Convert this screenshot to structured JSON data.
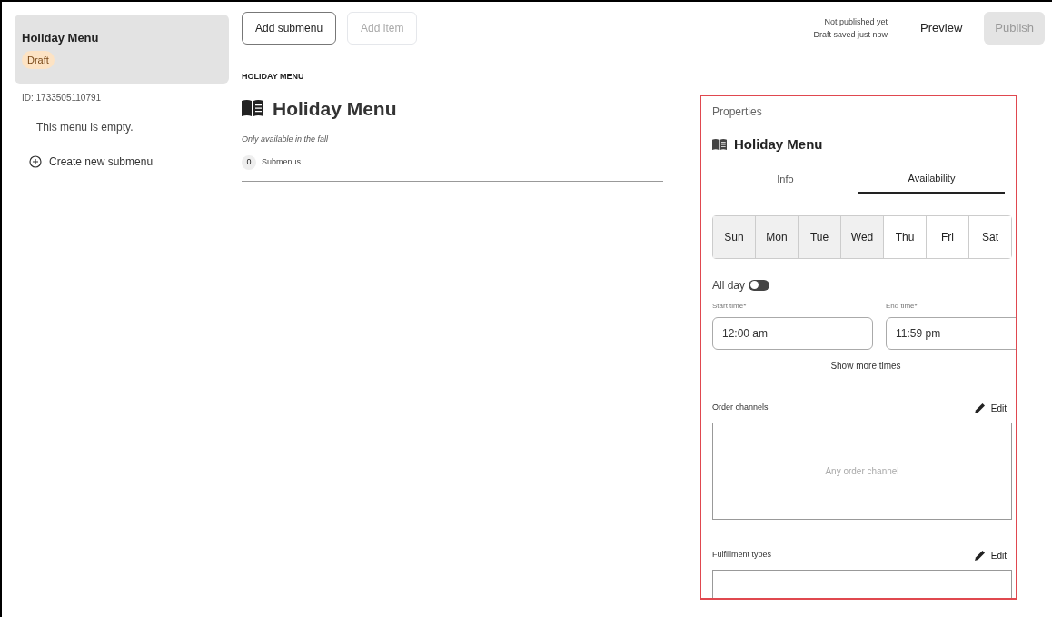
{
  "sidebar": {
    "card": {
      "title": "Holiday Menu",
      "badge": "Draft",
      "selected": true
    },
    "id_text": "ID: 1733505110791",
    "empty_text": "This menu is empty.",
    "create_link": "Create new submenu"
  },
  "toolbar": {
    "buttons": [
      {
        "label": "Add submenu",
        "disabled": false
      },
      {
        "label": "Add item",
        "disabled": true
      }
    ],
    "status_lines": [
      "Not published yet",
      "Draft saved just now"
    ],
    "preview": "Preview",
    "publish": {
      "label": "Publish",
      "disabled": true
    }
  },
  "content": {
    "eyebrow": "HOLIDAY MENU",
    "title": "Holiday Menu",
    "subtitle": "Only available in the fall",
    "count": "0",
    "count_label": "Submenus"
  },
  "properties": {
    "heading": "Properties",
    "title": "Holiday Menu",
    "tabs": [
      {
        "label": "Info",
        "selected": false
      },
      {
        "label": "Availability",
        "selected": true
      }
    ],
    "days": [
      {
        "label": "Sun",
        "selected": true
      },
      {
        "label": "Mon",
        "selected": true
      },
      {
        "label": "Tue",
        "selected": true
      },
      {
        "label": "Wed",
        "selected": true
      },
      {
        "label": "Thu",
        "selected": false
      },
      {
        "label": "Fri",
        "selected": false
      },
      {
        "label": "Sat",
        "selected": false
      }
    ],
    "all_day": {
      "label": "All day",
      "on": false
    },
    "times": [
      {
        "label": "Start time*",
        "value": "12:00 am"
      },
      {
        "label": "End time*",
        "value": "11:59 pm"
      }
    ],
    "show_more": "Show more times",
    "sections": [
      {
        "label": "Order channels",
        "edit": "Edit",
        "placeholder": "Any order channel"
      },
      {
        "label": "Fulfillment types",
        "edit": "Edit"
      }
    ]
  }
}
